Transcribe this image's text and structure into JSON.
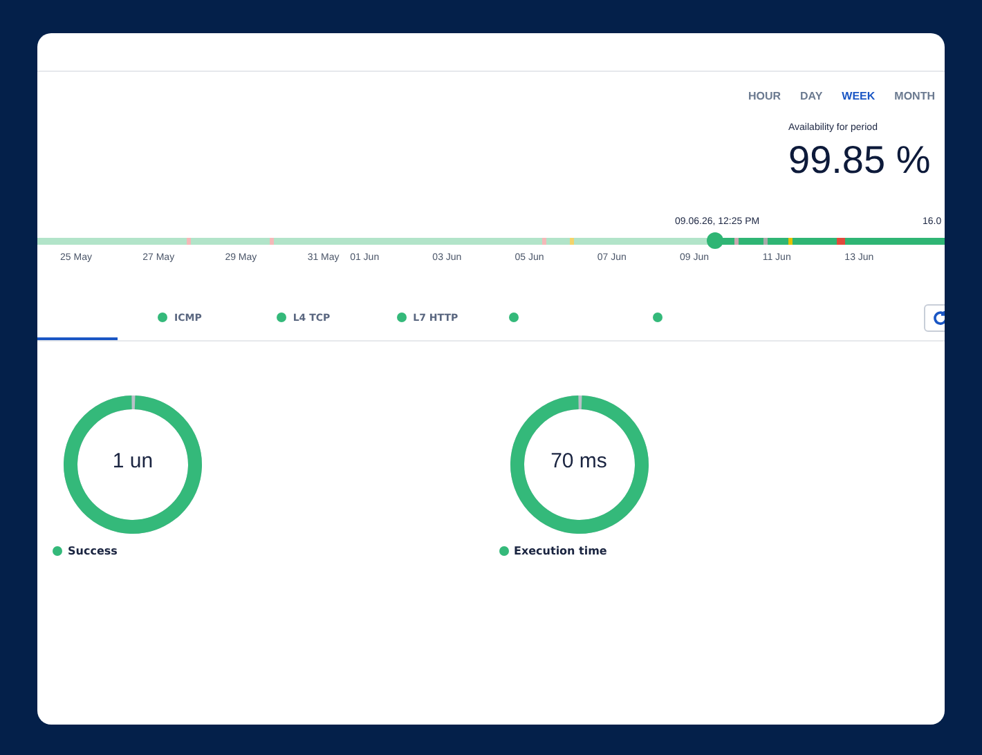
{
  "periods": [
    {
      "label": "HOUR",
      "selected": false
    },
    {
      "label": "DAY",
      "selected": false
    },
    {
      "label": "WEEK",
      "selected": true
    },
    {
      "label": "MONTH",
      "selected": false
    }
  ],
  "availability": {
    "label": "Availability for period",
    "value": "99.85 %"
  },
  "timeline": {
    "marker_label": "09.06.26, 12:25 PM",
    "end_label": "16.0",
    "dates": [
      "25 May",
      "27 May",
      "29 May",
      "31 May",
      "01 Jun",
      "03 Jun",
      "05 Jun",
      "07 Jun",
      "09 Jun",
      "11 Jun",
      "13 Jun"
    ]
  },
  "checks": [
    {
      "selected": true
    },
    {
      "label": "ICMP",
      "selected": false,
      "color": "#34b97a"
    },
    {
      "label": "L4 TCP",
      "selected": false,
      "color": "#34b97a"
    },
    {
      "label": "L7 HTTP",
      "selected": false,
      "color": "#34b97a"
    },
    {
      "selected": false,
      "color": "#34b97a"
    },
    {
      "selected": false,
      "color": "#34b97a"
    }
  ],
  "gauges": [
    {
      "value": "1 un",
      "legend": "Success",
      "color": "#34b97a"
    },
    {
      "value": "70 ms",
      "legend": "Execution time",
      "color": "#34b97a"
    }
  ]
}
